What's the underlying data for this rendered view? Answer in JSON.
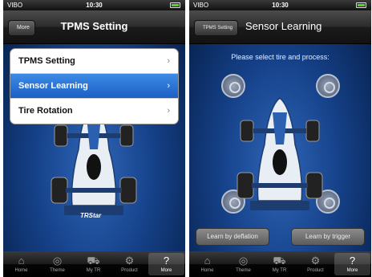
{
  "status_bar": {
    "carrier": "VIBO",
    "time": "10:30"
  },
  "screen_left": {
    "title": "TPMS Setting",
    "back_label": "More",
    "menu": [
      {
        "label": "TPMS Setting",
        "active": false
      },
      {
        "label": "Sensor Learning",
        "active": true
      },
      {
        "label": "Tire Rotation",
        "active": false
      }
    ],
    "chevron": "›"
  },
  "screen_right": {
    "title": "Sensor Learning",
    "back_label": "TPMS Setting",
    "instruction": "Please select tire and process:",
    "buttons": {
      "deflation": "Learn by deflation",
      "trigger": "Learn by trigger"
    }
  },
  "tab_bar": {
    "items": [
      {
        "label": "Home",
        "icon": "home-icon"
      },
      {
        "label": "Theme",
        "icon": "theme-icon"
      },
      {
        "label": "My TR",
        "icon": "car-icon"
      },
      {
        "label": "Product",
        "icon": "gears-icon"
      },
      {
        "label": "More",
        "icon": "help-icon"
      }
    ],
    "left_selected": "More",
    "right_selected": "More"
  },
  "logo_text": "TRStar",
  "colors": {
    "accent": "#1b5fc4",
    "background": "#16428a"
  }
}
